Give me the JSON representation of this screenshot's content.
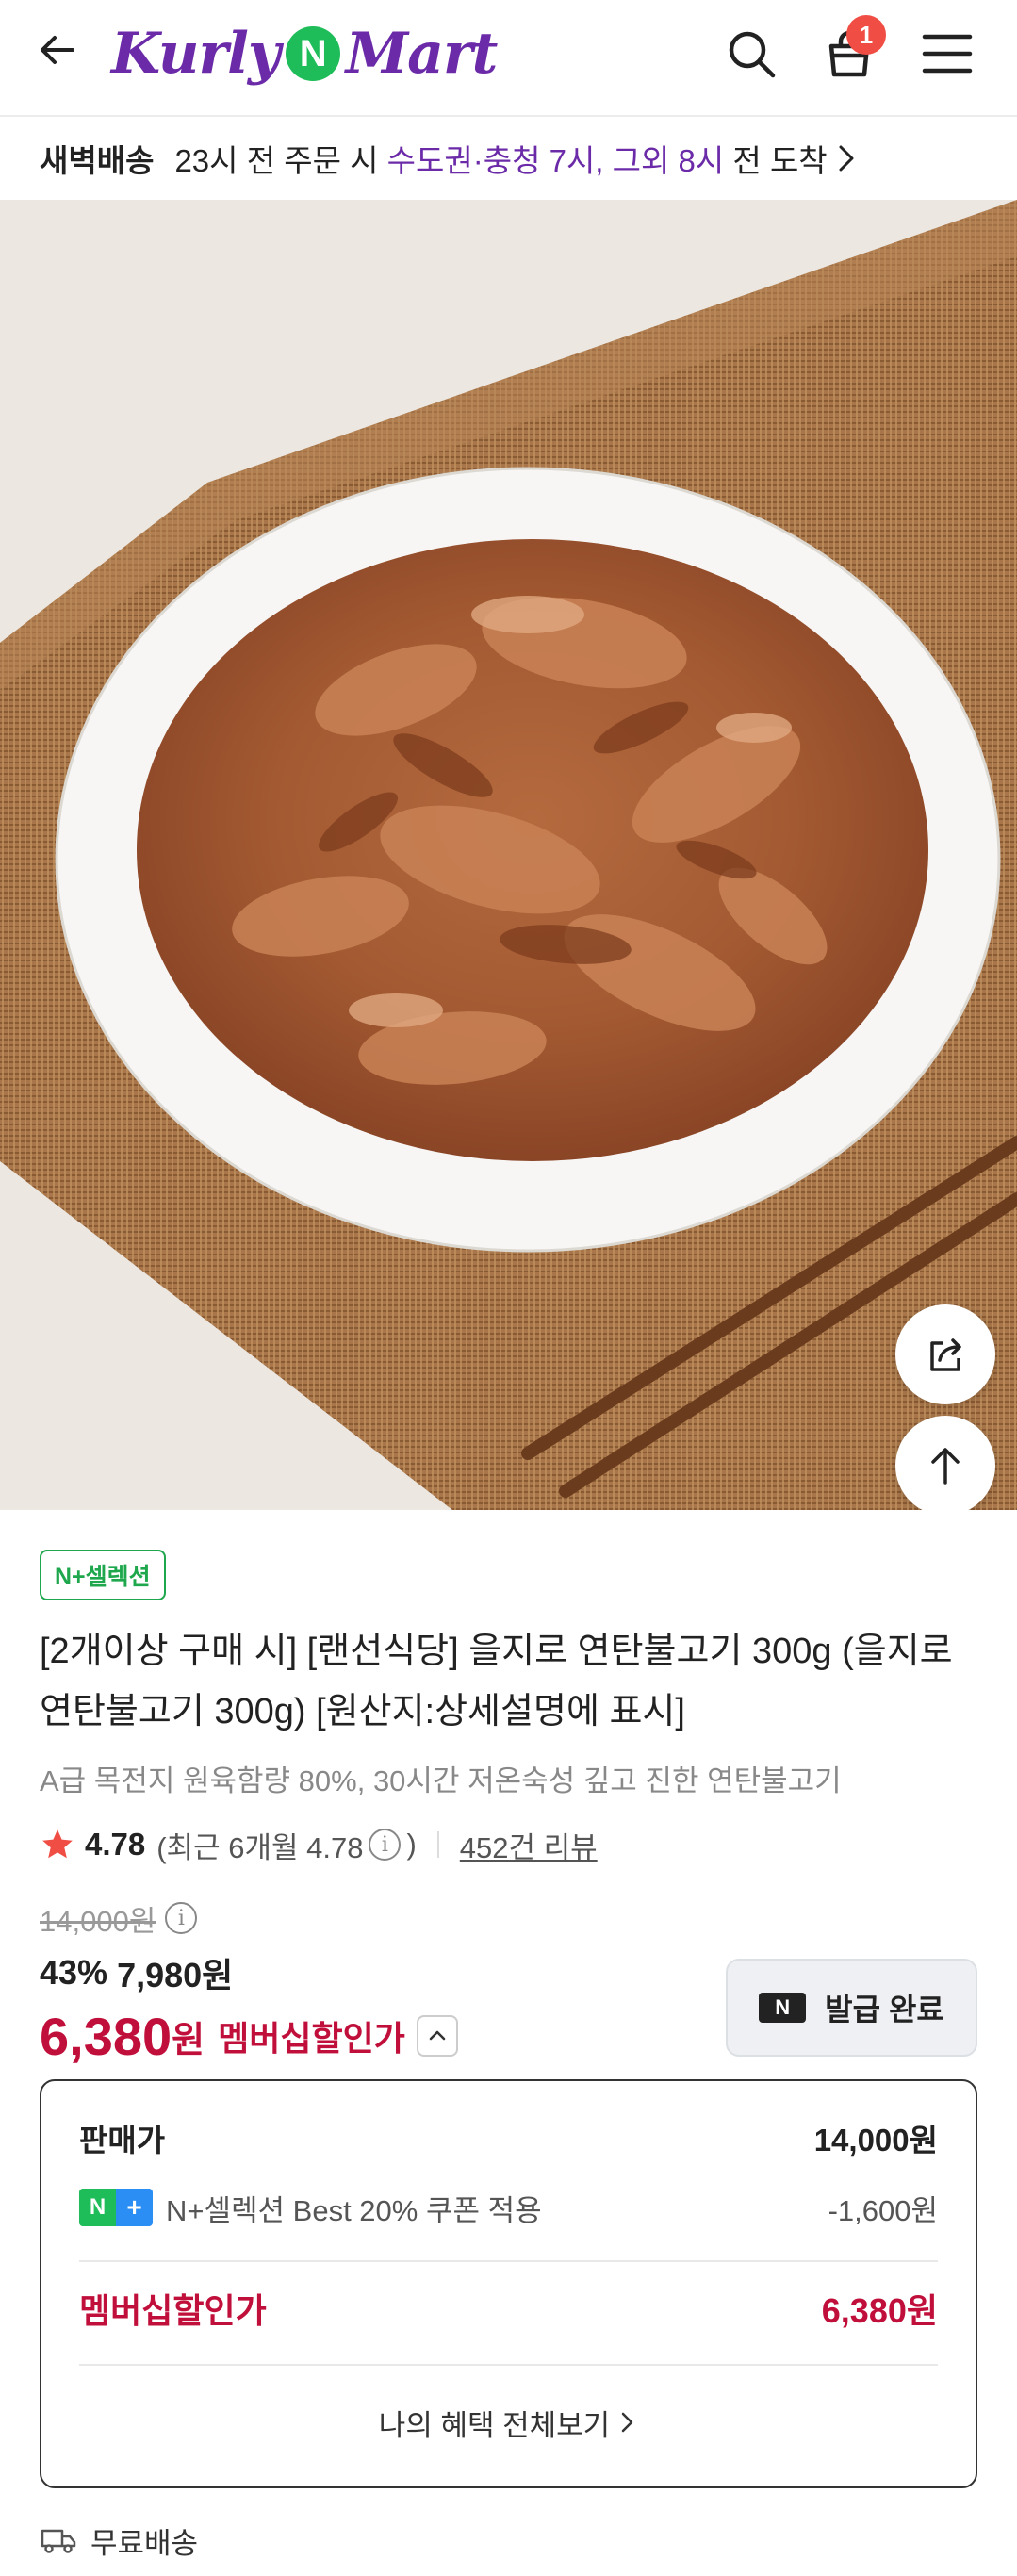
{
  "header": {
    "logo_left": "Kurly",
    "logo_mid": "N",
    "logo_right": "Mart",
    "cart_count": "1"
  },
  "delivery": {
    "label": "새벽배송",
    "text_before": "23시 전 주문 시",
    "highlight": "수도권·충청 7시, 그외 8시",
    "text_after": "전 도착"
  },
  "product": {
    "selection_tag": "N+셀렉션",
    "title": "[2개이상 구매 시] [랜선식당] 을지로 연탄불고기 300g (을지로 연탄불고기 300g) [원산지:상세설명에 표시]",
    "subtitle": "A급 목전지 원육함량 80%, 30시간 저온숙성 깊고 진한 연탄불고기",
    "rating": "4.78",
    "recent_rating_prefix": "(최근 6개월 4.78",
    "recent_rating_suffix": ")",
    "review_count": "452건 리뷰",
    "original_price": "14,000원",
    "discount_rate": "43%",
    "discount_price": "7,980원",
    "member_price": "6,380",
    "member_price_unit": "원",
    "member_price_label": "멤버십할인가",
    "coupon_button": "발급 완료",
    "coupon_button_logo": "N"
  },
  "price_box": {
    "sale_label": "판매가",
    "sale_value": "14,000원",
    "coupon_logo_a": "N",
    "coupon_logo_b": "+",
    "coupon_label": "N+셀렉션 Best 20% 쿠폰 적용",
    "coupon_value": "-1,600원",
    "member_label": "멤버십할인가",
    "member_value": "6,380원",
    "all_benefits": "나의 혜택 전체보기"
  },
  "shipping": {
    "label": "무료배송"
  },
  "colors": {
    "brand_purple": "#6b2aa8",
    "n_green": "#1fbd5a",
    "price_red": "#c00f3a",
    "badge_red": "#f04e45"
  },
  "icons": [
    "back-arrow-icon",
    "search-icon",
    "cart-icon",
    "menu-icon",
    "chevron-right-icon",
    "share-icon",
    "arrow-up-icon",
    "star-icon",
    "info-icon",
    "chevron-up-icon",
    "truck-icon"
  ]
}
